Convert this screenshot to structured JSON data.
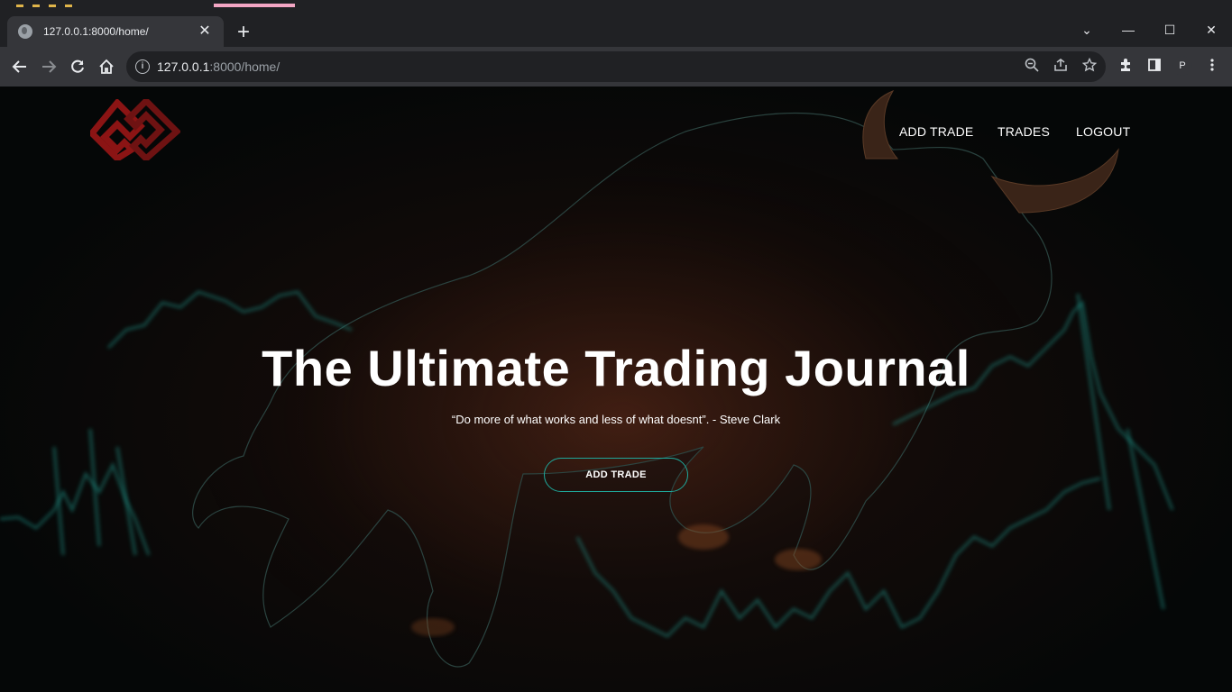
{
  "browser": {
    "tab_title": "127.0.0.1:8000/home/",
    "tab_close": "✕",
    "new_tab": "+",
    "url_host": "127.0.0.1",
    "url_rest": ":8000/home/",
    "profile_initial": "P",
    "window_controls": {
      "minimize": "—",
      "maximize": "☐",
      "close": "✕",
      "dropdown": "⌄"
    },
    "icons": [
      "back-icon",
      "forward-icon",
      "reload-icon",
      "home-icon",
      "info-icon",
      "zoom-icon",
      "share-icon",
      "star-icon",
      "extensions-icon",
      "side-panel-icon",
      "menu-icon"
    ]
  },
  "site": {
    "nav": {
      "add_trade": "ADD TRADE",
      "trades": "TRADES",
      "logout": "LOGOUT"
    },
    "hero": {
      "headline": "The Ultimate Trading Journal",
      "quote": "“Do more of what works and less of what doesnt”. - Steve Clark",
      "cta_label": "ADD TRADE"
    },
    "colors": {
      "logo_red": "#8b1414",
      "accent_teal": "#1fa79a",
      "text": "#ffffff"
    }
  }
}
